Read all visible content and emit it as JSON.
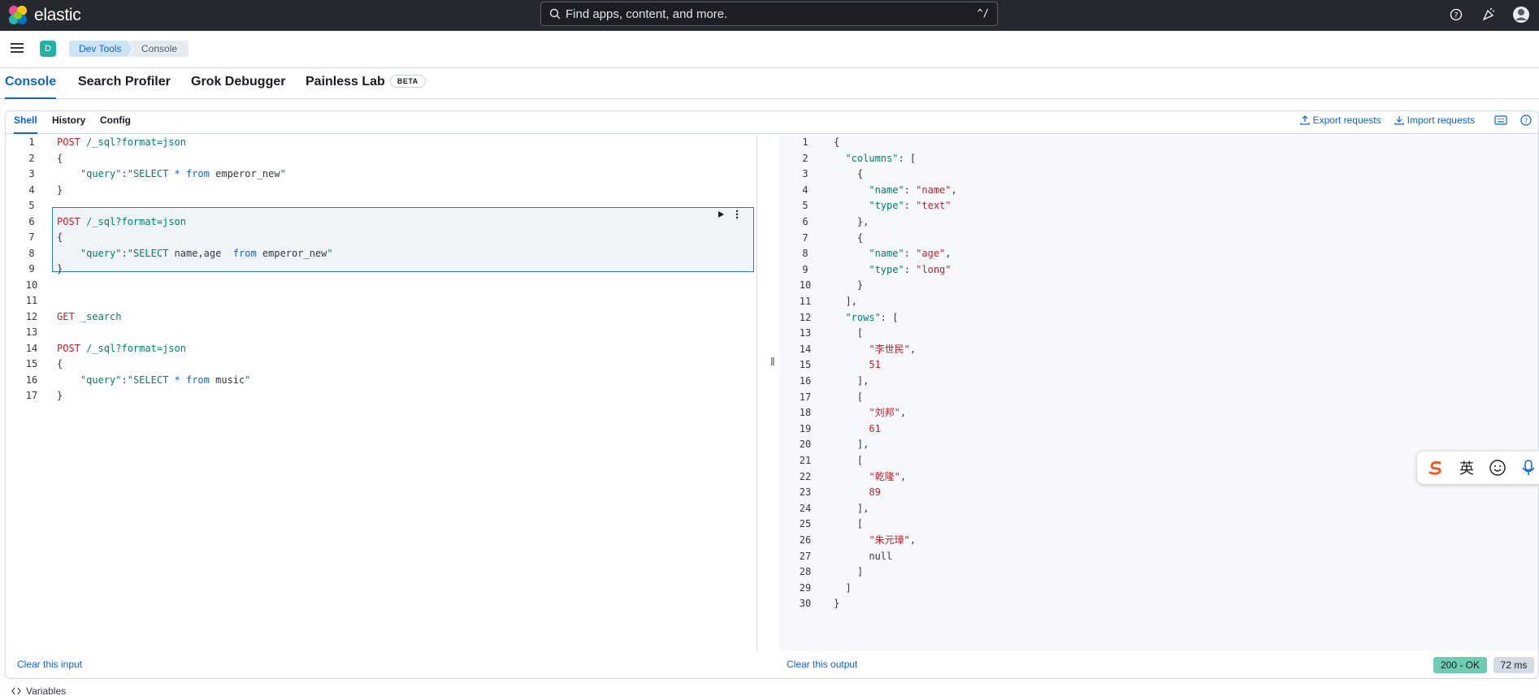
{
  "topbar": {
    "brand": "elastic",
    "search_placeholder": "Find apps, content, and more.",
    "search_shortcut": "^/"
  },
  "breadcrumbs": {
    "space_avatar": "D",
    "items": [
      "Dev Tools",
      "Console"
    ]
  },
  "tabs": [
    {
      "label": "Console",
      "active": true
    },
    {
      "label": "Search Profiler"
    },
    {
      "label": "Grok Debugger"
    },
    {
      "label": "Painless Lab",
      "badge": "BETA"
    }
  ],
  "subtabs": [
    {
      "label": "Shell",
      "active": true
    },
    {
      "label": "History"
    },
    {
      "label": "Config"
    }
  ],
  "tools": {
    "export": "Export requests",
    "import": "Import requests"
  },
  "editor": {
    "line_numbers": [
      "1",
      "2",
      "3",
      "4",
      "5",
      "6",
      "7",
      "8",
      "9",
      "10",
      "11",
      "12",
      "13",
      "14",
      "15",
      "16",
      "17"
    ],
    "lines": [
      [
        {
          "t": "POST",
          "c": "kw-method"
        },
        {
          "t": " /_sql?format=json",
          "c": "kw-url"
        }
      ],
      [
        {
          "t": "{",
          "c": ""
        }
      ],
      [
        {
          "t": "    \"query\"",
          "c": "kw-key"
        },
        {
          "t": ":",
          "c": ""
        },
        {
          "t": "\"SELECT ",
          "c": "kw-str"
        },
        {
          "t": "*",
          "c": "kw-sql"
        },
        {
          "t": " ",
          "c": ""
        },
        {
          "t": "from",
          "c": "kw-sql"
        },
        {
          "t": " emperor_new",
          "c": ""
        },
        {
          "t": "\"",
          "c": "kw-str"
        }
      ],
      [
        {
          "t": "}",
          "c": ""
        }
      ],
      [],
      [
        {
          "t": "POST",
          "c": "kw-method"
        },
        {
          "t": " /_sql?format=json",
          "c": "kw-url"
        }
      ],
      [
        {
          "t": "{",
          "c": ""
        }
      ],
      [
        {
          "t": "    \"query\"",
          "c": "kw-key"
        },
        {
          "t": ":",
          "c": ""
        },
        {
          "t": "\"SELECT ",
          "c": "kw-str"
        },
        {
          "t": "name,age  ",
          "c": ""
        },
        {
          "t": "from",
          "c": "kw-sql"
        },
        {
          "t": " emperor_new",
          "c": ""
        },
        {
          "t": "\"",
          "c": "kw-str"
        }
      ],
      [
        {
          "t": "}",
          "c": ""
        }
      ],
      [],
      [],
      [
        {
          "t": "GET",
          "c": "kw-method"
        },
        {
          "t": " _search",
          "c": "kw-url"
        }
      ],
      [],
      [
        {
          "t": "POST",
          "c": "kw-method"
        },
        {
          "t": " /_sql?format=json",
          "c": "kw-url"
        }
      ],
      [
        {
          "t": "{",
          "c": ""
        }
      ],
      [
        {
          "t": "    \"query\"",
          "c": "kw-key"
        },
        {
          "t": ":",
          "c": ""
        },
        {
          "t": "\"SELECT ",
          "c": "kw-str"
        },
        {
          "t": "*",
          "c": "kw-sql"
        },
        {
          "t": " ",
          "c": ""
        },
        {
          "t": "from",
          "c": "kw-sql"
        },
        {
          "t": " music",
          "c": ""
        },
        {
          "t": "\"",
          "c": "kw-str"
        }
      ],
      [
        {
          "t": "}",
          "c": ""
        }
      ]
    ],
    "clear_label": "Clear this input"
  },
  "output": {
    "line_numbers": [
      "1",
      "2",
      "3",
      "4",
      "5",
      "6",
      "7",
      "8",
      "9",
      "10",
      "11",
      "12",
      "13",
      "14",
      "15",
      "16",
      "17",
      "18",
      "19",
      "20",
      "21",
      "22",
      "23",
      "24",
      "25",
      "26",
      "27",
      "28",
      "29",
      "30"
    ],
    "lines": [
      [
        {
          "t": "{",
          "c": ""
        }
      ],
      [
        {
          "t": "  \"columns\"",
          "c": "kw-key"
        },
        {
          "t": ": [",
          "c": ""
        }
      ],
      [
        {
          "t": "    {",
          "c": ""
        }
      ],
      [
        {
          "t": "      \"name\"",
          "c": "kw-key"
        },
        {
          "t": ": ",
          "c": ""
        },
        {
          "t": "\"name\"",
          "c": "kw-val"
        },
        {
          "t": ",",
          "c": ""
        }
      ],
      [
        {
          "t": "      \"type\"",
          "c": "kw-key"
        },
        {
          "t": ": ",
          "c": ""
        },
        {
          "t": "\"text\"",
          "c": "kw-val"
        }
      ],
      [
        {
          "t": "    },",
          "c": ""
        }
      ],
      [
        {
          "t": "    {",
          "c": ""
        }
      ],
      [
        {
          "t": "      \"name\"",
          "c": "kw-key"
        },
        {
          "t": ": ",
          "c": ""
        },
        {
          "t": "\"age\"",
          "c": "kw-val"
        },
        {
          "t": ",",
          "c": ""
        }
      ],
      [
        {
          "t": "      \"type\"",
          "c": "kw-key"
        },
        {
          "t": ": ",
          "c": ""
        },
        {
          "t": "\"long\"",
          "c": "kw-val"
        }
      ],
      [
        {
          "t": "    }",
          "c": ""
        }
      ],
      [
        {
          "t": "  ],",
          "c": ""
        }
      ],
      [
        {
          "t": "  \"rows\"",
          "c": "kw-key"
        },
        {
          "t": ": [",
          "c": ""
        }
      ],
      [
        {
          "t": "    [",
          "c": ""
        }
      ],
      [
        {
          "t": "      \"李世民\"",
          "c": "kw-val"
        },
        {
          "t": ",",
          "c": ""
        }
      ],
      [
        {
          "t": "      51",
          "c": "kw-num"
        }
      ],
      [
        {
          "t": "    ],",
          "c": ""
        }
      ],
      [
        {
          "t": "    [",
          "c": ""
        }
      ],
      [
        {
          "t": "      \"刘邦\"",
          "c": "kw-val"
        },
        {
          "t": ",",
          "c": ""
        }
      ],
      [
        {
          "t": "      61",
          "c": "kw-num"
        }
      ],
      [
        {
          "t": "    ],",
          "c": ""
        }
      ],
      [
        {
          "t": "    [",
          "c": ""
        }
      ],
      [
        {
          "t": "      \"乾隆\"",
          "c": "kw-val"
        },
        {
          "t": ",",
          "c": ""
        }
      ],
      [
        {
          "t": "      89",
          "c": "kw-num"
        }
      ],
      [
        {
          "t": "    ],",
          "c": ""
        }
      ],
      [
        {
          "t": "    [",
          "c": ""
        }
      ],
      [
        {
          "t": "      \"朱元璋\"",
          "c": "kw-val"
        },
        {
          "t": ",",
          "c": ""
        }
      ],
      [
        {
          "t": "      null",
          "c": ""
        }
      ],
      [
        {
          "t": "    ]",
          "c": ""
        }
      ],
      [
        {
          "t": "  ]",
          "c": ""
        }
      ],
      [
        {
          "t": "}",
          "c": ""
        }
      ]
    ],
    "clear_label": "Clear this output",
    "status": "200 - OK",
    "time": "72 ms"
  },
  "footer": {
    "variables_label": "Variables"
  },
  "ime": {
    "lang": "英"
  }
}
